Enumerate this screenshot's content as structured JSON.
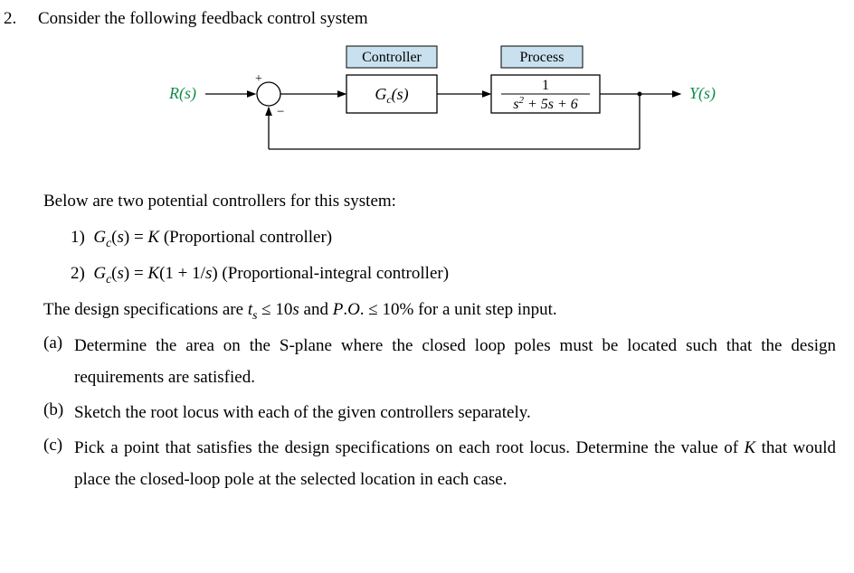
{
  "question_number": "2.",
  "intro": "Consider the following feedback control system",
  "diagram": {
    "input_label": "R(s)",
    "output_label": "Y(s)",
    "plus_sign": "+",
    "minus_sign": "−",
    "controller_title": "Controller",
    "controller_tf": "G_c(s)",
    "process_title": "Process",
    "process_numer": "1",
    "process_denom": "s² + 5s + 6"
  },
  "controllers_intro": "Below are two potential controllers for this system:",
  "ctrl1_num": "1)",
  "ctrl1_tf_lhs": "G_c(s) = K",
  "ctrl1_desc": "(Proportional controller)",
  "ctrl2_num": "2)",
  "ctrl2_tf_lhs": "G_c(s) = K(1 + 1/s)",
  "ctrl2_desc": "(Proportional-integral controller)",
  "spec_line_prefix": "The design specifications are",
  "spec_ts": "t_s ≤ 10s",
  "spec_and": "and",
  "spec_po": "P.O. ≤ 10%",
  "spec_suffix": "for a unit step input.",
  "parts": {
    "a_lbl": "(a)",
    "a_text": "Determine the area on the S-plane where the closed loop poles must be located such that the design requirements are satisfied.",
    "b_lbl": "(b)",
    "b_text": "Sketch the root locus with each of the given controllers separately.",
    "c_lbl": "(c)",
    "c_text_1": "Pick a point that satisfies the design specifications on each root locus. Determine the value of",
    "c_K": "K",
    "c_text_2": "that would place the closed-loop pole at the selected location in each case."
  }
}
